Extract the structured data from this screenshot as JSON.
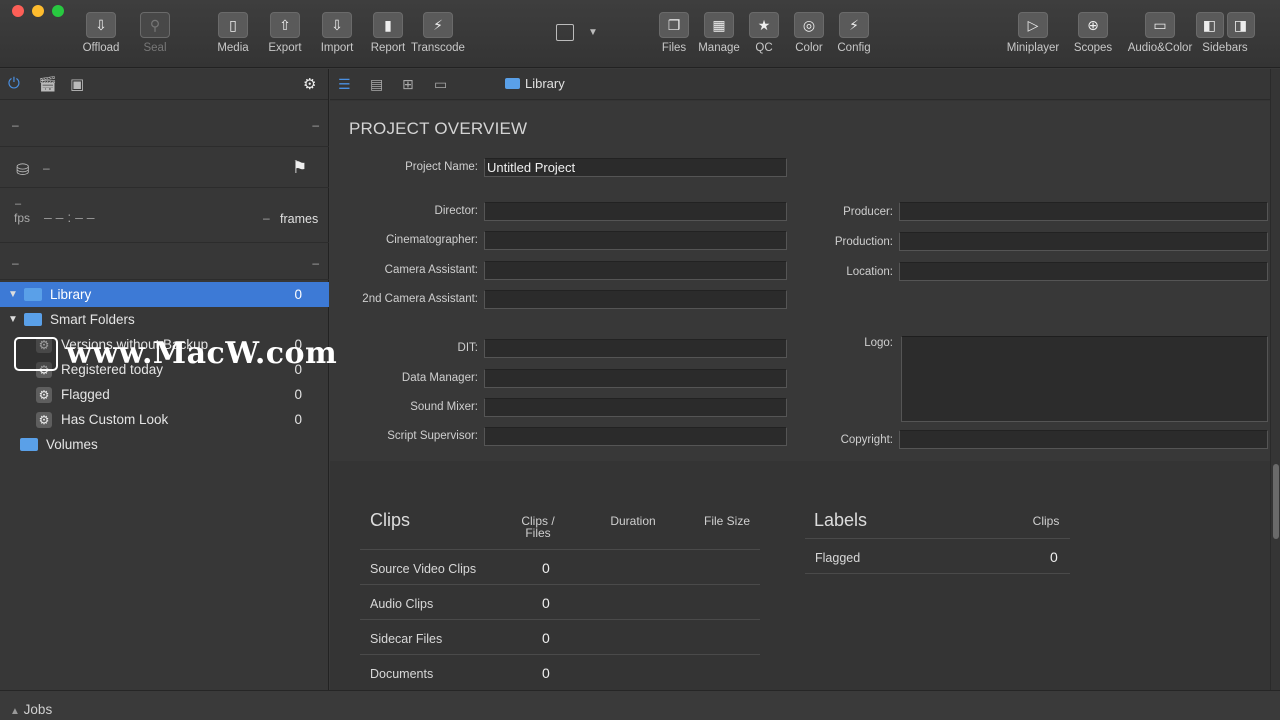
{
  "toolbar": {
    "left_buttons": [
      {
        "label": "Offload",
        "icon": "offload-icon",
        "enabled": true
      },
      {
        "label": "Seal",
        "icon": "seal-icon",
        "enabled": false
      },
      {
        "label": "Media",
        "icon": "media-icon",
        "enabled": true
      },
      {
        "label": "Export",
        "icon": "export-icon",
        "enabled": true
      },
      {
        "label": "Import",
        "icon": "import-icon",
        "enabled": true
      },
      {
        "label": "Report",
        "icon": "report-icon",
        "enabled": true
      },
      {
        "label": "Transcode",
        "icon": "transcode-icon",
        "enabled": true
      }
    ],
    "right_buttons": [
      {
        "label": "Files",
        "icon": "files-icon"
      },
      {
        "label": "Manage",
        "icon": "manage-icon"
      },
      {
        "label": "QC",
        "icon": "star-icon"
      },
      {
        "label": "Color",
        "icon": "color-icon"
      },
      {
        "label": "Config",
        "icon": "bolt-icon"
      },
      {
        "label": "Miniplayer",
        "icon": "play-icon"
      },
      {
        "label": "Scopes",
        "icon": "scopes-icon"
      },
      {
        "label": "Audio&Color",
        "icon": "audio-color-icon"
      },
      {
        "label": "Sidebars",
        "icon": "sidebars-icon"
      }
    ]
  },
  "sidebar": {
    "info": {
      "row1_left": "–",
      "row1_right": "–",
      "drive_value": "–",
      "fps_top": "–",
      "fps_label": "fps",
      "timecode": "– – : – –",
      "frames_dash": "–",
      "frames_label": "frames",
      "row4_left": "–",
      "row4_right": "–"
    },
    "tree": [
      {
        "label": "Library",
        "count": "0",
        "selected": true
      },
      {
        "label": "Smart Folders",
        "count": ""
      },
      {
        "label": "Versions without Backup",
        "count": "0"
      },
      {
        "label": "Registered today",
        "count": "0"
      },
      {
        "label": "Flagged",
        "count": "0"
      },
      {
        "label": "Has Custom Look",
        "count": "0"
      },
      {
        "label": "Volumes",
        "count": ""
      }
    ]
  },
  "main": {
    "breadcrumb": "Library",
    "overview_title": "PROJECT OVERVIEW",
    "fields_left": {
      "project_name_label": "Project Name:",
      "project_name_value": "Untitled Project",
      "director": "Director:",
      "cinematographer": "Cinematographer:",
      "camera_assistant": "Camera Assistant:",
      "second_camera_assistant": "2nd Camera Assistant:",
      "dit": "DIT:",
      "data_manager": "Data Manager:",
      "sound_mixer": "Sound Mixer:",
      "script_supervisor": "Script Supervisor:"
    },
    "fields_right": {
      "producer": "Producer:",
      "production": "Production:",
      "location": "Location:",
      "logo": "Logo:",
      "copyright": "Copyright:"
    },
    "clips": {
      "title": "Clips",
      "col_clips_files_1": "Clips /",
      "col_clips_files_2": "Files",
      "col_duration": "Duration",
      "col_file_size": "File Size",
      "rows": [
        {
          "label": "Source Video Clips",
          "value": "0"
        },
        {
          "label": "Audio Clips",
          "value": "0"
        },
        {
          "label": "Sidecar Files",
          "value": "0"
        },
        {
          "label": "Documents",
          "value": "0"
        }
      ]
    },
    "labels": {
      "title": "Labels",
      "col_clips": "Clips",
      "rows": [
        {
          "label": "Flagged",
          "value": "0"
        }
      ]
    }
  },
  "jobs": {
    "label": "Jobs"
  },
  "watermark": {
    "text": "www.MacW.com"
  }
}
